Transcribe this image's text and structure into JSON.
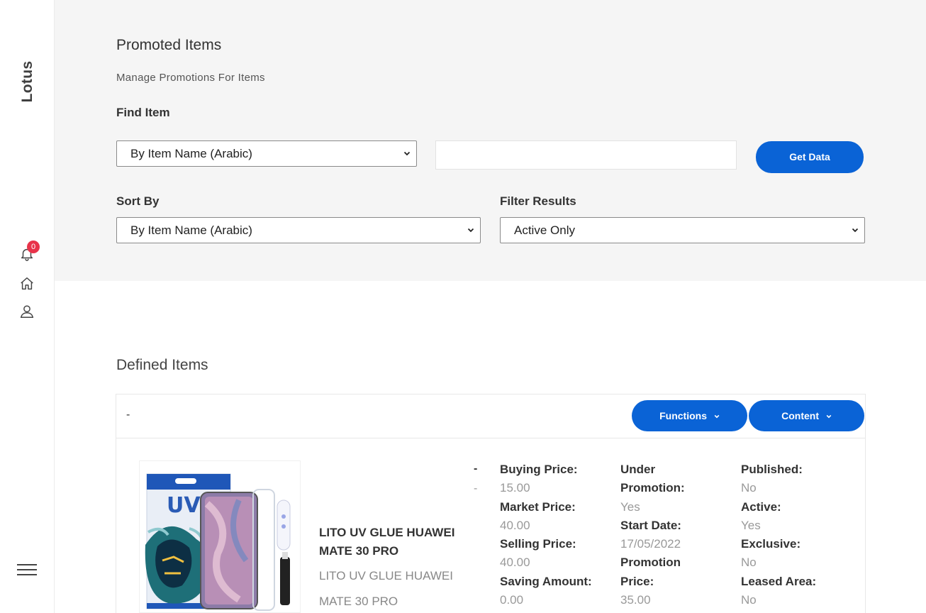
{
  "brand": "Lotus",
  "sidebar": {
    "notification_count": "0",
    "icons": [
      "bell-icon",
      "home-icon",
      "user-icon",
      "menu-icon"
    ]
  },
  "header": {
    "title": "Promoted Items",
    "subtitle": "Manage Promotions For Items"
  },
  "find_item": {
    "label": "Find Item",
    "search_by_selected": "By Item Name (Arabic)",
    "search_value": "",
    "button_label": "Get Data"
  },
  "sort_by": {
    "label": "Sort By",
    "selected": "By Item Name (Arabic)"
  },
  "filter": {
    "label": "Filter Results",
    "selected": "Active Only"
  },
  "defined_items": {
    "title": "Defined Items",
    "card_header_text": "-",
    "functions_label": "Functions",
    "content_label": "Content"
  },
  "item": {
    "name": "LITO UV GLUE HUAWEI MATE 30 PRO",
    "sub_name_line1": "LITO UV GLUE HUAWEI",
    "sub_name_line2": "MATE 30 PRO",
    "dash_bold": "-",
    "dash_light": "-",
    "col1": [
      {
        "key": "Buying Price:",
        "value": "15.00"
      },
      {
        "key": "Market Price:",
        "value": "40.00"
      },
      {
        "key": "Selling Price:",
        "value": "40.00"
      },
      {
        "key": "Saving Amount:",
        "value": "0.00"
      }
    ],
    "col2": [
      {
        "key": "Under Promotion:",
        "value": "Yes"
      },
      {
        "key": "Start Date:",
        "value": "17/05/2022"
      },
      {
        "key": "Promotion Price:",
        "value": "35.00"
      }
    ],
    "col3": [
      {
        "key": "Published:",
        "value": "No"
      },
      {
        "key": "Active:",
        "value": "Yes"
      },
      {
        "key": "Exclusive:",
        "value": "No"
      },
      {
        "key": "Leased Area:",
        "value": "No"
      }
    ]
  },
  "colors": {
    "accent": "#0a63d6",
    "badge": "#e8334a",
    "panel_bg": "#f5f5f5"
  }
}
